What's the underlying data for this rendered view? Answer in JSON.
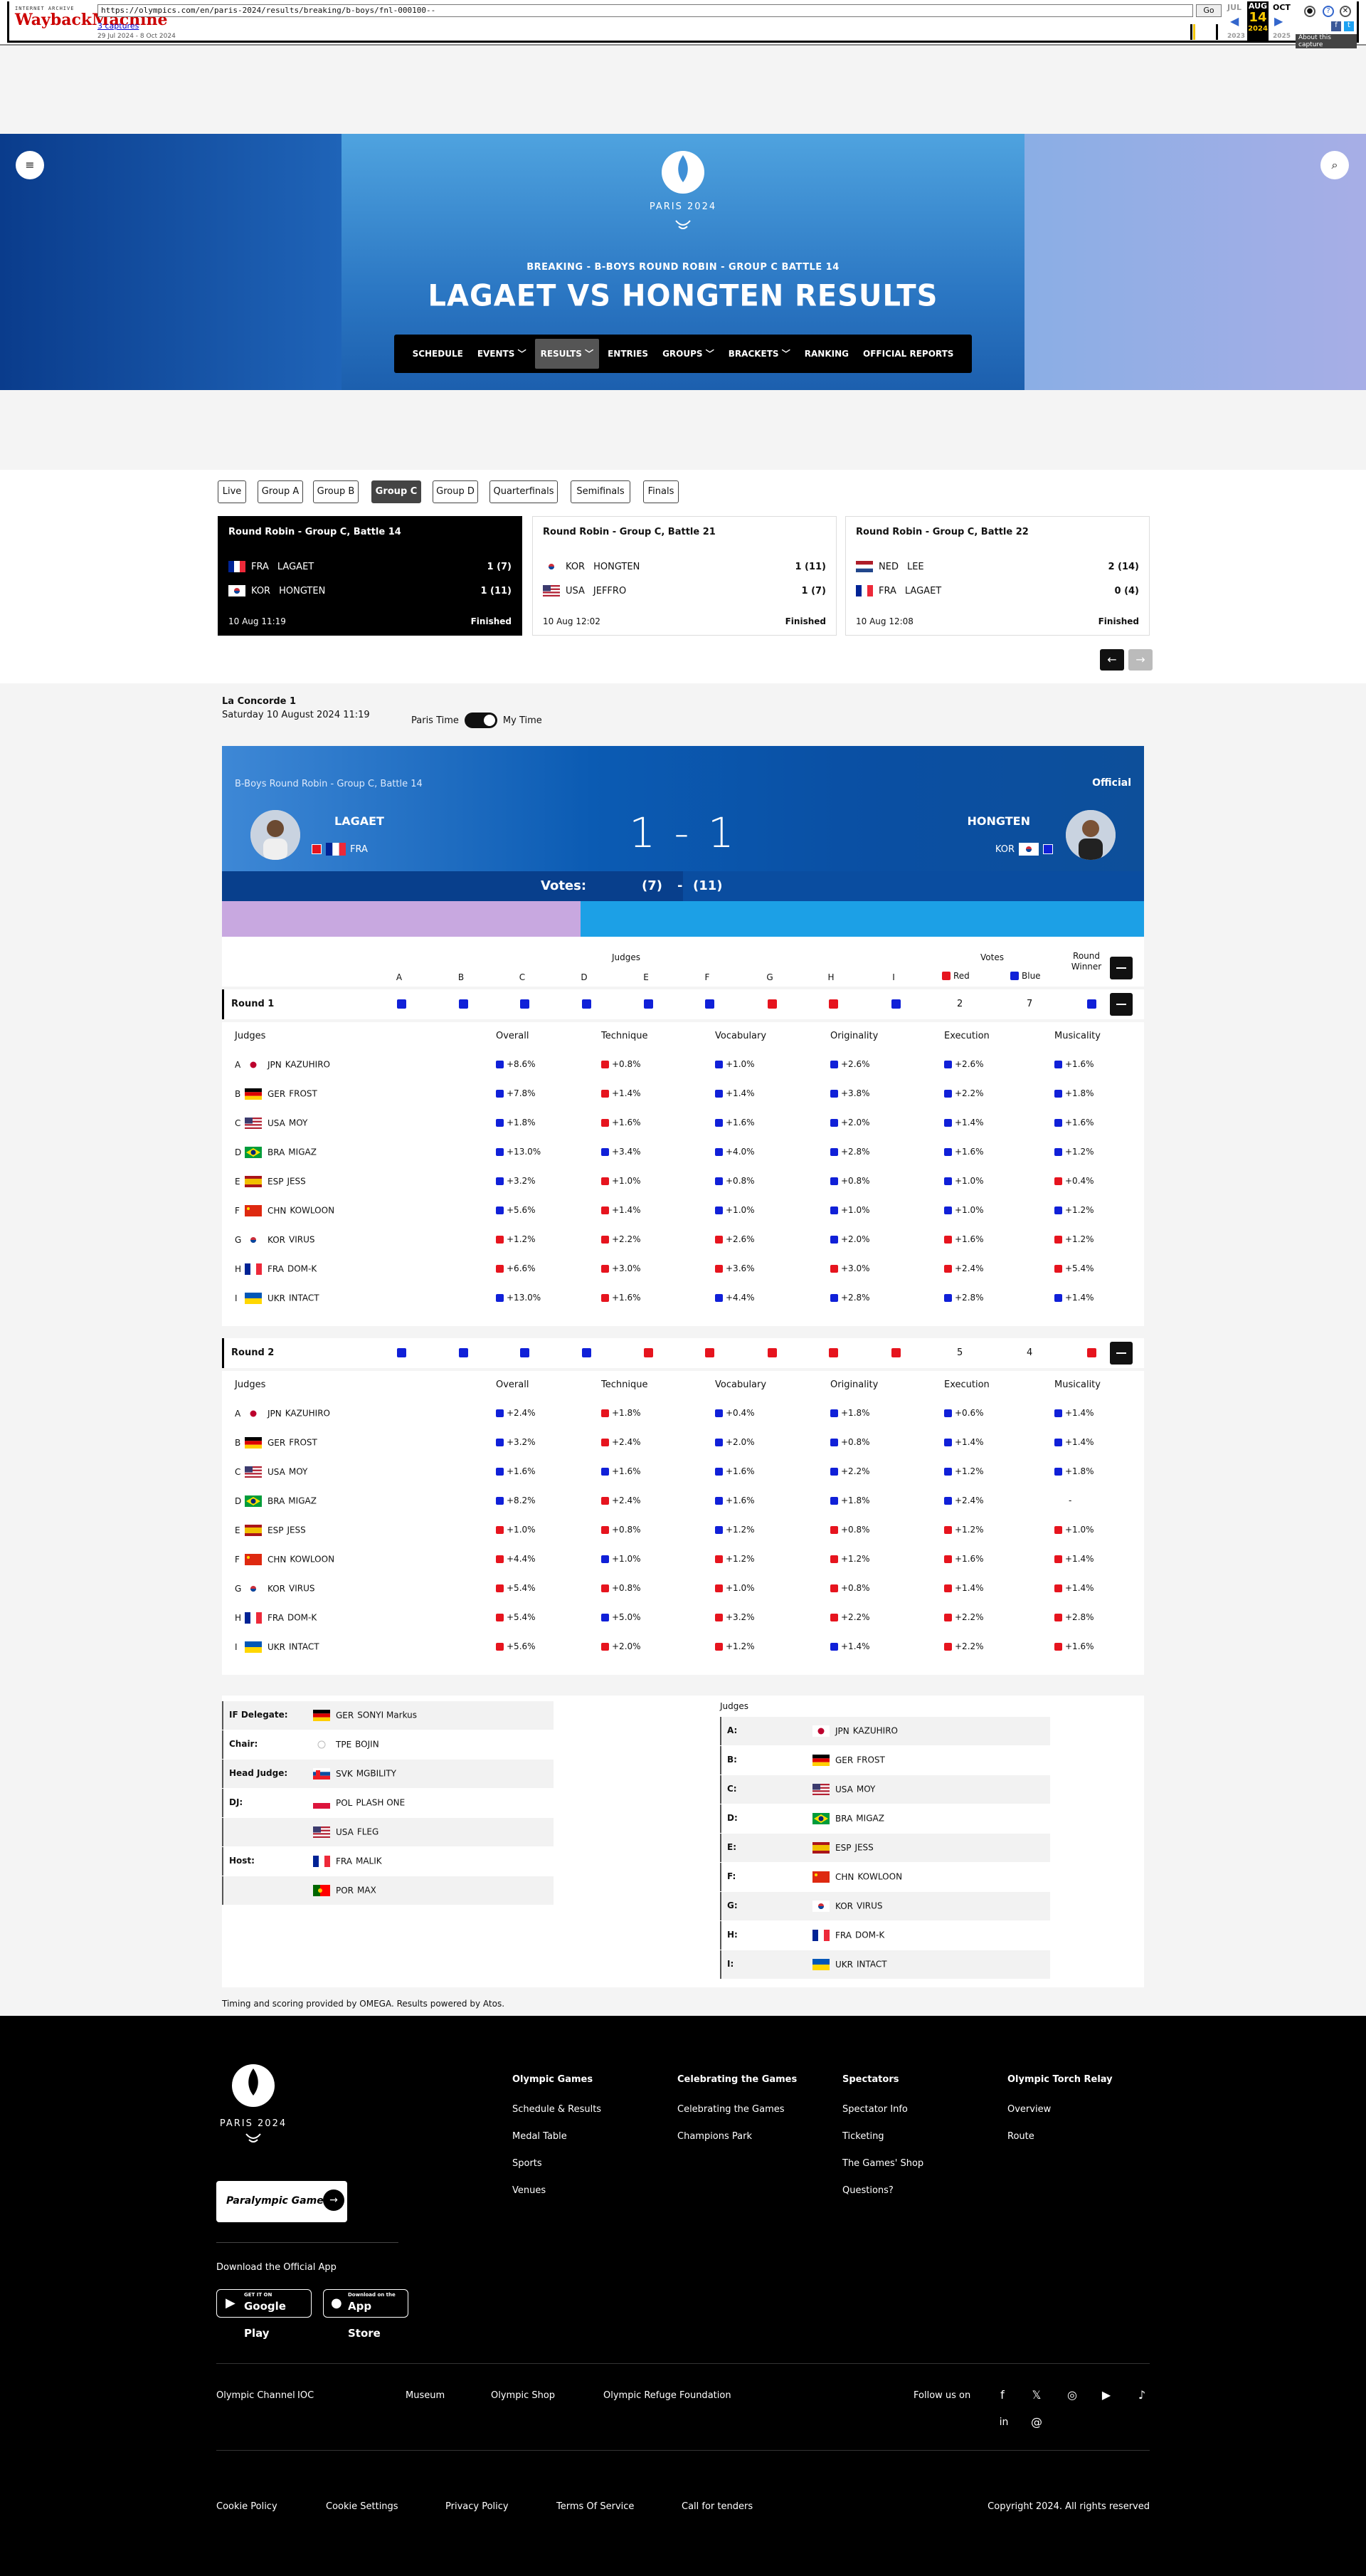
{
  "wayback": {
    "url": "https://olympics.com/en/paris-2024/results/breaking/b-boys/fnl-000100--",
    "go": "Go",
    "captures": "3 captures",
    "range": "29 Jul 2024 - 8 Oct 2024",
    "months": [
      "JUL",
      "AUG",
      "OCT"
    ],
    "day": "14",
    "year": "2024",
    "prev_year": "2023",
    "next_year": "2025",
    "about": "About this capture",
    "logo_top": "INTERNET ARCHIVE",
    "logo_main": "WaybackMachine"
  },
  "header": {
    "brand": "PARIS 2024",
    "subtitle": "BREAKING - B-BOYS ROUND ROBIN - GROUP C BATTLE 14",
    "title": "LAGAET VS HONGTEN RESULTS",
    "nav": [
      "SCHEDULE",
      "EVENTS",
      "RESULTS",
      "ENTRIES",
      "GROUPS",
      "BRACKETS",
      "RANKING",
      "OFFICIAL REPORTS"
    ]
  },
  "tabs": [
    "Live",
    "Group A",
    "Group B",
    "Group C",
    "Group D",
    "Quarterfinals",
    "Semifinals",
    "Finals"
  ],
  "active_tab": "Group C",
  "battles": [
    {
      "title": "Round Robin - Group C, Battle 14",
      "rows": [
        {
          "code": "FRA",
          "name": "LAGAET",
          "score": "1 (7)"
        },
        {
          "code": "KOR",
          "name": "HONGTEN",
          "score": "1 (11)"
        }
      ],
      "time": "10 Aug 11:19",
      "status": "Finished"
    },
    {
      "title": "Round Robin - Group C, Battle 21",
      "rows": [
        {
          "code": "KOR",
          "name": "HONGTEN",
          "score": "1 (11)"
        },
        {
          "code": "USA",
          "name": "JEFFRO",
          "score": "1 (7)"
        }
      ],
      "time": "10 Aug 12:02",
      "status": "Finished"
    },
    {
      "title": "Round Robin - Group C, Battle 22",
      "rows": [
        {
          "code": "NED",
          "name": "LEE",
          "score": "2 (14)"
        },
        {
          "code": "FRA",
          "name": "LAGAET",
          "score": "0 (4)"
        }
      ],
      "time": "10 Aug 12:08",
      "status": "Finished"
    }
  ],
  "venue": {
    "name": "La Concorde 1",
    "date": "Saturday 10 August 2024 11:19",
    "paris_time": "Paris Time",
    "my_time": "My Time"
  },
  "scoreboard": {
    "label": "B-Boys Round Robin - Group C, Battle 14",
    "official": "Official",
    "left_name": "LAGAET",
    "left_noc": "FRA",
    "right_name": "HONGTEN",
    "right_noc": "KOR",
    "score": "1 - 1",
    "votes_label": "Votes:",
    "votes_left": "(7)",
    "votes_sep": "-",
    "votes_right": "(11)"
  },
  "judges_header": {
    "judges": "Judges",
    "votes": "Votes",
    "red": "Red",
    "blue": "Blue",
    "round_winner": "Round Winner",
    "letters": [
      "A",
      "B",
      "C",
      "D",
      "E",
      "F",
      "G",
      "H",
      "I"
    ]
  },
  "columns": [
    "Judges",
    "Overall",
    "Technique",
    "Vocabulary",
    "Originality",
    "Execution",
    "Musicality"
  ],
  "rounds": [
    {
      "title": "Round 1",
      "red_votes": "2",
      "blue_votes": "7",
      "judge_votes": [
        "blue",
        "blue",
        "blue",
        "blue",
        "blue",
        "blue",
        "red",
        "red",
        "blue"
      ],
      "winner": "blue",
      "rows": [
        {
          "l": "A",
          "noc": "JPN",
          "name": "KAZUHIRO",
          "v": [
            [
              "blue",
              "+8.6%"
            ],
            [
              "red",
              "+0.8%"
            ],
            [
              "blue",
              "+1.0%"
            ],
            [
              "blue",
              "+2.6%"
            ],
            [
              "blue",
              "+2.6%"
            ],
            [
              "blue",
              "+1.6%"
            ]
          ]
        },
        {
          "l": "B",
          "noc": "GER",
          "name": "FROST",
          "v": [
            [
              "blue",
              "+7.8%"
            ],
            [
              "red",
              "+1.4%"
            ],
            [
              "blue",
              "+1.4%"
            ],
            [
              "blue",
              "+3.8%"
            ],
            [
              "blue",
              "+2.2%"
            ],
            [
              "blue",
              "+1.8%"
            ]
          ]
        },
        {
          "l": "C",
          "noc": "USA",
          "name": "MOY",
          "v": [
            [
              "blue",
              "+1.8%"
            ],
            [
              "red",
              "+1.6%"
            ],
            [
              "blue",
              "+1.6%"
            ],
            [
              "blue",
              "+2.0%"
            ],
            [
              "blue",
              "+1.4%"
            ],
            [
              "blue",
              "+1.6%"
            ]
          ]
        },
        {
          "l": "D",
          "noc": "BRA",
          "name": "MIGAZ",
          "v": [
            [
              "blue",
              "+13.0%"
            ],
            [
              "blue",
              "+3.4%"
            ],
            [
              "blue",
              "+4.0%"
            ],
            [
              "blue",
              "+2.8%"
            ],
            [
              "blue",
              "+1.6%"
            ],
            [
              "blue",
              "+1.2%"
            ]
          ]
        },
        {
          "l": "E",
          "noc": "ESP",
          "name": "JESS",
          "v": [
            [
              "blue",
              "+3.2%"
            ],
            [
              "red",
              "+1.0%"
            ],
            [
              "blue",
              "+0.8%"
            ],
            [
              "blue",
              "+0.8%"
            ],
            [
              "blue",
              "+1.0%"
            ],
            [
              "red",
              "+0.4%"
            ]
          ]
        },
        {
          "l": "F",
          "noc": "CHN",
          "name": "KOWLOON",
          "v": [
            [
              "blue",
              "+5.6%"
            ],
            [
              "red",
              "+1.4%"
            ],
            [
              "blue",
              "+1.0%"
            ],
            [
              "blue",
              "+1.0%"
            ],
            [
              "blue",
              "+1.0%"
            ],
            [
              "blue",
              "+1.2%"
            ]
          ]
        },
        {
          "l": "G",
          "noc": "KOR",
          "name": "VIRUS",
          "v": [
            [
              "red",
              "+1.2%"
            ],
            [
              "red",
              "+2.2%"
            ],
            [
              "red",
              "+2.6%"
            ],
            [
              "blue",
              "+2.0%"
            ],
            [
              "red",
              "+1.6%"
            ],
            [
              "red",
              "+1.2%"
            ]
          ]
        },
        {
          "l": "H",
          "noc": "FRA",
          "name": "DOM-K",
          "v": [
            [
              "red",
              "+6.6%"
            ],
            [
              "red",
              "+3.0%"
            ],
            [
              "red",
              "+3.6%"
            ],
            [
              "red",
              "+3.0%"
            ],
            [
              "red",
              "+2.4%"
            ],
            [
              "red",
              "+5.4%"
            ]
          ]
        },
        {
          "l": "I",
          "noc": "UKR",
          "name": "INTACT",
          "v": [
            [
              "blue",
              "+13.0%"
            ],
            [
              "red",
              "+1.6%"
            ],
            [
              "blue",
              "+4.4%"
            ],
            [
              "blue",
              "+2.8%"
            ],
            [
              "blue",
              "+2.8%"
            ],
            [
              "blue",
              "+1.4%"
            ]
          ]
        }
      ]
    },
    {
      "title": "Round 2",
      "red_votes": "5",
      "blue_votes": "4",
      "judge_votes": [
        "blue",
        "blue",
        "blue",
        "blue",
        "red",
        "red",
        "red",
        "red",
        "red"
      ],
      "winner": "red",
      "rows": [
        {
          "l": "A",
          "noc": "JPN",
          "name": "KAZUHIRO",
          "v": [
            [
              "blue",
              "+2.4%"
            ],
            [
              "red",
              "+1.8%"
            ],
            [
              "blue",
              "+0.4%"
            ],
            [
              "blue",
              "+1.8%"
            ],
            [
              "blue",
              "+0.6%"
            ],
            [
              "blue",
              "+1.4%"
            ]
          ]
        },
        {
          "l": "B",
          "noc": "GER",
          "name": "FROST",
          "v": [
            [
              "blue",
              "+3.2%"
            ],
            [
              "red",
              "+2.4%"
            ],
            [
              "blue",
              "+2.0%"
            ],
            [
              "blue",
              "+0.8%"
            ],
            [
              "blue",
              "+1.4%"
            ],
            [
              "blue",
              "+1.4%"
            ]
          ]
        },
        {
          "l": "C",
          "noc": "USA",
          "name": "MOY",
          "v": [
            [
              "blue",
              "+1.6%"
            ],
            [
              "blue",
              "+1.6%"
            ],
            [
              "blue",
              "+1.6%"
            ],
            [
              "blue",
              "+2.2%"
            ],
            [
              "blue",
              "+1.2%"
            ],
            [
              "blue",
              "+1.8%"
            ]
          ]
        },
        {
          "l": "D",
          "noc": "BRA",
          "name": "MIGAZ",
          "v": [
            [
              "blue",
              "+8.2%"
            ],
            [
              "red",
              "+2.4%"
            ],
            [
              "blue",
              "+1.6%"
            ],
            [
              "blue",
              "+1.8%"
            ],
            [
              "blue",
              "+2.4%"
            ],
            [
              "none",
              "-"
            ]
          ]
        },
        {
          "l": "E",
          "noc": "ESP",
          "name": "JESS",
          "v": [
            [
              "red",
              "+1.0%"
            ],
            [
              "red",
              "+0.8%"
            ],
            [
              "blue",
              "+1.2%"
            ],
            [
              "red",
              "+0.8%"
            ],
            [
              "red",
              "+1.2%"
            ],
            [
              "red",
              "+1.0%"
            ]
          ]
        },
        {
          "l": "F",
          "noc": "CHN",
          "name": "KOWLOON",
          "v": [
            [
              "red",
              "+4.4%"
            ],
            [
              "blue",
              "+1.0%"
            ],
            [
              "red",
              "+1.2%"
            ],
            [
              "red",
              "+1.2%"
            ],
            [
              "red",
              "+1.6%"
            ],
            [
              "red",
              "+1.4%"
            ]
          ]
        },
        {
          "l": "G",
          "noc": "KOR",
          "name": "VIRUS",
          "v": [
            [
              "red",
              "+5.4%"
            ],
            [
              "red",
              "+0.8%"
            ],
            [
              "red",
              "+1.0%"
            ],
            [
              "red",
              "+0.8%"
            ],
            [
              "red",
              "+1.4%"
            ],
            [
              "red",
              "+1.4%"
            ]
          ]
        },
        {
          "l": "H",
          "noc": "FRA",
          "name": "DOM-K",
          "v": [
            [
              "red",
              "+5.4%"
            ],
            [
              "blue",
              "+5.0%"
            ],
            [
              "red",
              "+3.2%"
            ],
            [
              "red",
              "+2.2%"
            ],
            [
              "red",
              "+2.2%"
            ],
            [
              "red",
              "+2.8%"
            ]
          ]
        },
        {
          "l": "I",
          "noc": "UKR",
          "name": "INTACT",
          "v": [
            [
              "red",
              "+5.6%"
            ],
            [
              "red",
              "+2.0%"
            ],
            [
              "red",
              "+1.2%"
            ],
            [
              "blue",
              "+1.4%"
            ],
            [
              "red",
              "+2.2%"
            ],
            [
              "red",
              "+1.6%"
            ]
          ]
        }
      ]
    }
  ],
  "officials": [
    {
      "k": "IF Delegate:",
      "noc": "GER",
      "v": "SONYI Markus"
    },
    {
      "k": "Chair:",
      "noc": "TPE",
      "v": "BOJIN"
    },
    {
      "k": "Head Judge:",
      "noc": "SVK",
      "v": "MGBILITY"
    },
    {
      "k": "DJ:",
      "noc": "POL",
      "v": "PLASH ONE"
    },
    {
      "k": "",
      "noc": "USA",
      "v": "FLEG"
    },
    {
      "k": "Host:",
      "noc": "FRA",
      "v": "MALIK"
    },
    {
      "k": "",
      "noc": "POR",
      "v": "MAX"
    }
  ],
  "judges_list_title": "Judges",
  "judges_list": [
    {
      "k": "A:",
      "noc": "JPN",
      "v": "KAZUHIRO"
    },
    {
      "k": "B:",
      "noc": "GER",
      "v": "FROST"
    },
    {
      "k": "C:",
      "noc": "USA",
      "v": "MOY"
    },
    {
      "k": "D:",
      "noc": "BRA",
      "v": "MIGAZ"
    },
    {
      "k": "E:",
      "noc": "ESP",
      "v": "JESS"
    },
    {
      "k": "F:",
      "noc": "CHN",
      "v": "KOWLOON"
    },
    {
      "k": "G:",
      "noc": "KOR",
      "v": "VIRUS"
    },
    {
      "k": "H:",
      "noc": "FRA",
      "v": "DOM-K"
    },
    {
      "k": "I:",
      "noc": "UKR",
      "v": "INTACT"
    }
  ],
  "timing_note": "Timing and scoring provided by OMEGA. Results powered by Atos.",
  "footer": {
    "brand": "PARIS 2024",
    "paralympic": "Paralympic Games",
    "download": "Download the Official App",
    "google": "Google Play",
    "google_small": "GET IT ON",
    "apple": "App Store",
    "apple_small": "Download on the",
    "cols": [
      {
        "h": "Olympic Games",
        "items": [
          "Schedule & Results",
          "Medal Table",
          "Sports",
          "Venues"
        ]
      },
      {
        "h": "Celebrating the Games",
        "items": [
          "Celebrating the Games",
          "Champions Park"
        ]
      },
      {
        "h": "Spectators",
        "items": [
          "Spectator Info",
          "Ticketing",
          "The Games' Shop",
          "Questions?"
        ]
      },
      {
        "h": "Olympic Torch Relay",
        "items": [
          "Overview",
          "Route"
        ]
      }
    ],
    "links": [
      "Olympic Channel",
      "IOC",
      "Museum",
      "Olympic Shop",
      "Olympic Refuge Foundation"
    ],
    "follow": "Follow us on",
    "legal": [
      "Cookie Policy",
      "Cookie Settings",
      "Privacy Policy",
      "Terms Of Service",
      "Call for tenders"
    ],
    "copyright": "Copyright 2024. All rights reserved"
  },
  "colors": {
    "red": "#e6141e",
    "blue": "#1020d8",
    "accent": "#0b5bb3"
  }
}
